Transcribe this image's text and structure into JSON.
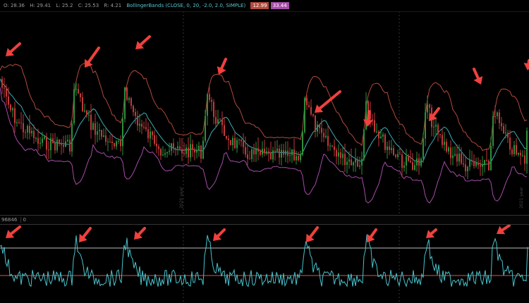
{
  "header": {
    "open": "O: 28.36",
    "high": "H: 29.41",
    "low": "L: 25.2",
    "close": "C: 25.53",
    "change": "R: 4.21",
    "study": "BollingerBands (CLOSE, 0, 20, -2.0, 2.0, SIMPLE)",
    "value_upper": "12.99",
    "value_lower": "33.44"
  },
  "lower_panel": {
    "label": "96846",
    "extra": "0"
  },
  "dates": [
    "2020 year",
    "2021 year"
  ],
  "colors": {
    "price_up": "#2e8f3b",
    "price_down": "#c0393a",
    "upper_band": "#b14a3c",
    "lower_band": "#a64ca8",
    "mid_band": "#3aaeb6",
    "oscillator": "#49c3cc",
    "arrow": "#f0413d",
    "upper_level": "#bdbdbd",
    "lower_level": "#d45a4a"
  },
  "chart_data": [
    {
      "type": "candlestick",
      "study": "BollingerBands",
      "spikes": [
        0,
        106,
        177,
        293,
        432,
        519,
        604,
        700,
        750
      ],
      "annotations": "red arrows point at volatility spikes"
    },
    {
      "type": "line",
      "series": [
        {
          "values": "oscillator"
        }
      ],
      "reference_lines": [
        "upper",
        "lower"
      ]
    }
  ]
}
